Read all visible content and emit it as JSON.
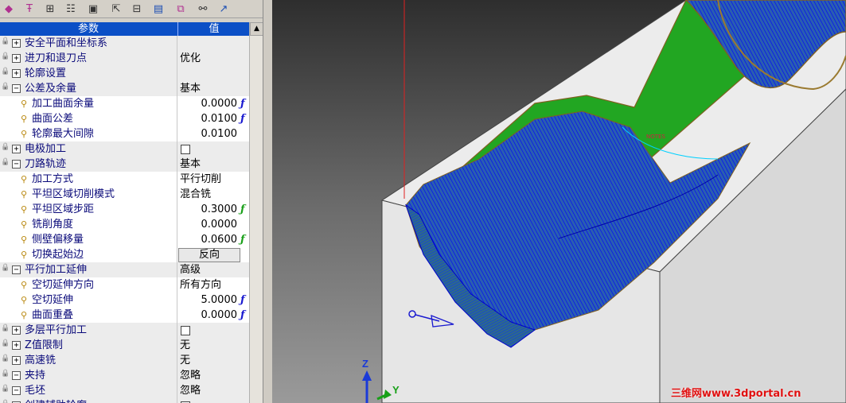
{
  "toolbar": {
    "icons": [
      "eraser-icon",
      "pin-icon",
      "group-icon",
      "list-icon",
      "monitor-icon",
      "export-icon",
      "tree-icon",
      "save-icon",
      "copy-icon",
      "link-icon",
      "cursor-icon"
    ]
  },
  "grid": {
    "header": {
      "param": "参数",
      "value": "值"
    },
    "rows": [
      {
        "name": "安全平面和坐标系",
        "value": "",
        "kind": "group",
        "expand": "+",
        "lock": true
      },
      {
        "name": "进刀和退刀点",
        "value": "优化",
        "kind": "group",
        "expand": "+",
        "lock": true
      },
      {
        "name": "轮廓设置",
        "value": "",
        "kind": "group",
        "expand": "+",
        "lock": true
      },
      {
        "name": "公差及余量",
        "value": "基本",
        "kind": "group",
        "expand": "-",
        "lock": true
      },
      {
        "name": "加工曲面余量",
        "value": "0.0000",
        "kind": "sub",
        "numeric": true,
        "fx": "blue"
      },
      {
        "name": "曲面公差",
        "value": "0.0100",
        "kind": "sub",
        "numeric": true,
        "fx": "blue"
      },
      {
        "name": "轮廓最大间隙",
        "value": "0.0100",
        "kind": "sub",
        "numeric": true
      },
      {
        "name": "电极加工",
        "value": "",
        "kind": "group",
        "expand": "+",
        "lock": true,
        "checkbox": true
      },
      {
        "name": "刀路轨迹",
        "value": "基本",
        "kind": "group",
        "expand": "-",
        "lock": true
      },
      {
        "name": "加工方式",
        "value": "平行切削",
        "kind": "sub"
      },
      {
        "name": "平坦区域切削模式",
        "value": "混合铣",
        "kind": "sub"
      },
      {
        "name": "平坦区域步距",
        "value": "0.3000",
        "kind": "sub",
        "numeric": true,
        "fx": "green"
      },
      {
        "name": "铣削角度",
        "value": "0.0000",
        "kind": "sub",
        "numeric": true
      },
      {
        "name": "侧壁偏移量",
        "value": "0.0600",
        "kind": "sub",
        "numeric": true,
        "fx": "green"
      },
      {
        "name": "切换起始边",
        "value": "反向",
        "kind": "sub",
        "button": true
      },
      {
        "name": "平行加工延伸",
        "value": "高级",
        "kind": "group",
        "expand": "-",
        "lock": true
      },
      {
        "name": "空切延伸方向",
        "value": "所有方向",
        "kind": "sub"
      },
      {
        "name": "空切延伸",
        "value": "5.0000",
        "kind": "sub",
        "numeric": true,
        "fx": "blue"
      },
      {
        "name": "曲面重叠",
        "value": "0.0000",
        "kind": "sub",
        "numeric": true,
        "fx": "blue"
      },
      {
        "name": "多层平行加工",
        "value": "",
        "kind": "group",
        "expand": "+",
        "lock": true,
        "checkbox": true
      },
      {
        "name": "Z值限制",
        "value": "无",
        "kind": "group",
        "expand": "+",
        "lock": true
      },
      {
        "name": "高速铣",
        "value": "无",
        "kind": "group",
        "expand": "+",
        "lock": true
      },
      {
        "name": "夹持",
        "value": "忽略",
        "kind": "group",
        "expand": "-",
        "lock": true
      },
      {
        "name": "毛坯",
        "value": "忽略",
        "kind": "group",
        "expand": "-",
        "lock": true
      },
      {
        "name": "创建辅助轮廓",
        "value": "",
        "kind": "group",
        "expand": "-",
        "lock": true,
        "checkbox": true
      }
    ]
  },
  "viewport": {
    "axis_z": "Z",
    "axis_y": "Y",
    "mid_label": "NOTES",
    "watermark": "三维网www.3dportal.cn",
    "colors": {
      "toolpath": "#1a1aff",
      "surface": "#1fa21f",
      "block_top": "#ececec",
      "background": "#3a3a3a"
    }
  },
  "scrollbar": {
    "up_arrow": "▲"
  }
}
